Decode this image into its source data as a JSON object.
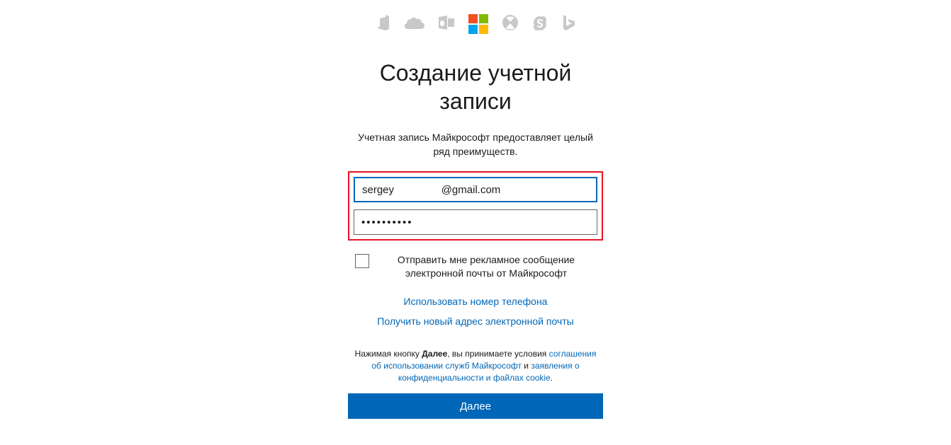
{
  "title": "Создание учетной записи",
  "subtitle": "Учетная запись Майкрософт предоставляет целый ряд преимуществ.",
  "form": {
    "email_value": "sergey                @gmail.com",
    "password_value": "••••••••••"
  },
  "promo_checkbox_label": "Отправить мне рекламное сообщение электронной почты от Майкрософт",
  "links": {
    "use_phone": "Использовать номер телефона",
    "get_new_email": "Получить новый адрес электронной почты"
  },
  "legal": {
    "prefix": "Нажимая кнопку ",
    "bold": "Далее",
    "mid1": ", вы принимаете условия ",
    "link1": "соглашения об использовании служб Майкрософт",
    "mid2": " и ",
    "link2": "заявления о конфиденциальности и файлах cookie",
    "suffix": "."
  },
  "next_button": "Далее",
  "icons": {
    "office": "office-icon",
    "onedrive": "onedrive-icon",
    "outlook": "outlook-icon",
    "microsoft": "microsoft-logo-icon",
    "xbox": "xbox-icon",
    "skype": "skype-icon",
    "bing": "bing-icon"
  }
}
